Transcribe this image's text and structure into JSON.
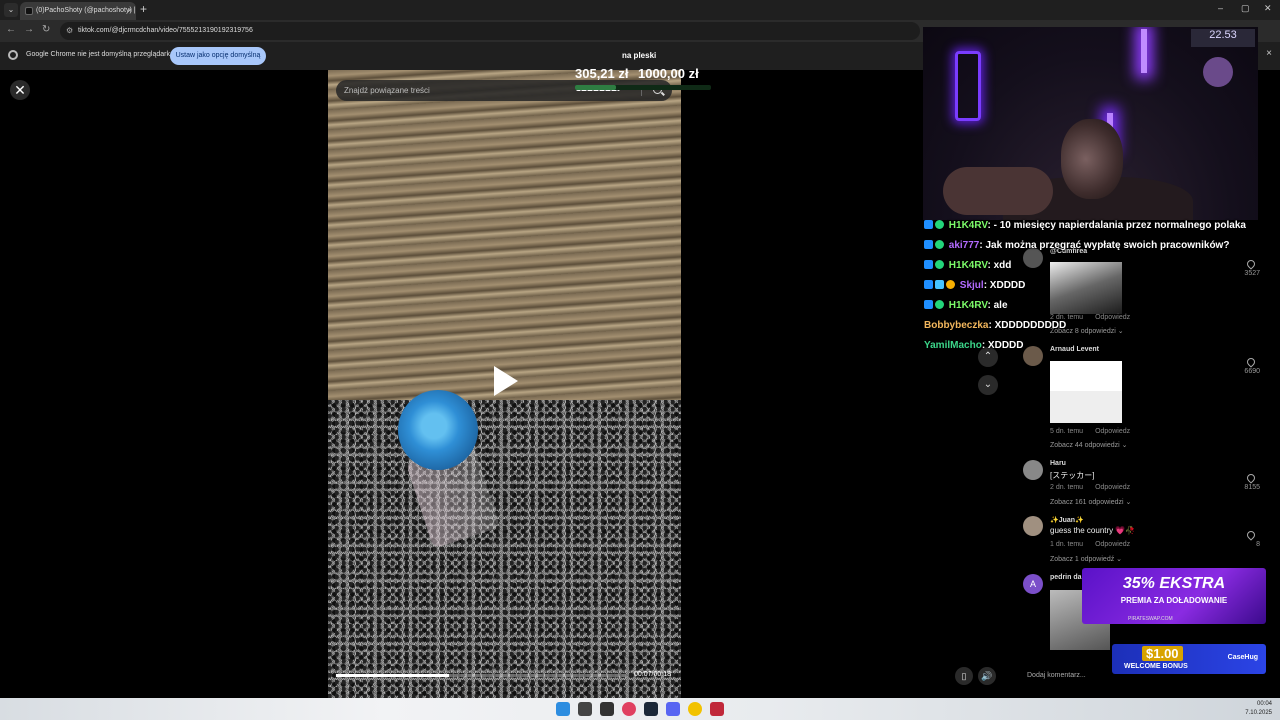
{
  "browser": {
    "tab_title": "(0)PachoShoty (@pachoshoty) |",
    "tab_menu": "⌄",
    "tab_close": "×",
    "newtab": "+",
    "url": "tiktok.com/@djcrmcdchan/video/7555213190192319756",
    "back": "←",
    "forward": "→",
    "reload": "↻",
    "infobar_text": "Google Chrome nie jest domyślną przeglądarką",
    "infobar_button": "Ustaw jako opcję domyślną",
    "infobar_close": "×",
    "min": "–",
    "max": "▢",
    "close": "✕"
  },
  "goal": {
    "title": "na pleski",
    "current": "305,21 zł",
    "target": "1000,00 zł",
    "progress": 0.305
  },
  "tiktok": {
    "close_label": "✕",
    "search_placeholder": "Znajdź powiązane treści",
    "time": "00:07/00:18",
    "progress": 0.39,
    "arrow_up": "⌃",
    "arrow_down": "⌄",
    "comment_placeholder": "Dodaj komentarz...",
    "ctrl_left": "▯",
    "ctrl_volume": "🔊",
    "comments": [
      {
        "name": "@Cumfirea",
        "date": "2 dn. temu",
        "reply": "Odpowiedz",
        "more": "Zobacz 8 odpowiedzi ⌄",
        "likes": "3527"
      },
      {
        "name": "Arnaud Levent",
        "date": "5 dn. temu",
        "reply": "Odpowiedz",
        "more": "Zobacz 44 odpowiedzi ⌄",
        "likes": "6690"
      },
      {
        "name": "Haru",
        "text": "[ステッカー]",
        "date": "2 dn. temu",
        "reply": "Odpowiedz",
        "more": "Zobacz 161 odpowiedzi ⌄",
        "likes": "8155"
      },
      {
        "name": "✨Juan✨",
        "text": "guess the country 💗🥀",
        "date": "1 dn. temu",
        "reply": "Odpowiedz",
        "more": "Zobacz 1 odpowiedź ⌄",
        "likes": "8"
      },
      {
        "name": "pedrin da",
        "avatar_letter": "A"
      }
    ]
  },
  "chat": [
    {
      "user": "H1K4RV",
      "color": "#7dfc6a",
      "message": ": - 10 miesięcy napierdalania przez normalnego polaka"
    },
    {
      "user": "aki777",
      "color": "#b36bff",
      "message": ": Jak można przegrać wypłatę swoich pracowników?"
    },
    {
      "user": "H1K4RV",
      "color": "#7dfc6a",
      "message": ": xdd"
    },
    {
      "user": "Skjul",
      "color": "#b36bff",
      "message": ": XDDDD"
    },
    {
      "user": "H1K4RV",
      "color": "#7dfc6a",
      "message": ": ale"
    },
    {
      "user": "Bobbybeczka",
      "color": "#f3b75d",
      "message": ": XDDDDDDDDD"
    },
    {
      "user": "YamilMacho",
      "color": "#3cd68a",
      "message": ": XDDDD"
    }
  ],
  "webcam": {
    "badge": "22.53"
  },
  "ads": {
    "title": "35% EKSTRA",
    "subtitle": "PREMIA ZA DOŁADOWANIE",
    "site": "PIRATESWAP.COM",
    "bonus_amount": "$1.00",
    "bonus_label": "WELCOME BONUS",
    "bonus_brand": "CaseHug"
  },
  "taskbar": {
    "time": "00:04",
    "date": "7.10.2025"
  }
}
